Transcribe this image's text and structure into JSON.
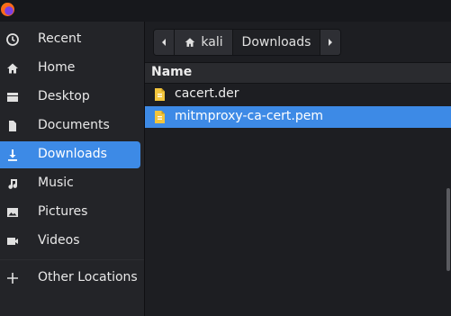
{
  "sidebar": {
    "items": [
      {
        "label": "Recent",
        "icon": "clock-icon"
      },
      {
        "label": "Home",
        "icon": "home-icon"
      },
      {
        "label": "Desktop",
        "icon": "desktop-icon"
      },
      {
        "label": "Documents",
        "icon": "document-icon"
      },
      {
        "label": "Downloads",
        "icon": "download-icon",
        "active": true
      },
      {
        "label": "Music",
        "icon": "music-icon"
      },
      {
        "label": "Pictures",
        "icon": "picture-icon"
      },
      {
        "label": "Videos",
        "icon": "video-icon"
      },
      {
        "label": "Other Locations",
        "icon": "plus-icon"
      }
    ]
  },
  "pathbar": {
    "home_label": "kali",
    "current_label": "Downloads"
  },
  "file_list": {
    "column_name": "Name",
    "files": [
      {
        "name": "cacert.der",
        "selected": false
      },
      {
        "name": "mitmproxy-ca-cert.pem",
        "selected": true
      }
    ]
  },
  "colors": {
    "accent": "#3d8ae6",
    "sidebar_bg": "#232428",
    "main_bg": "#1d1e22",
    "file_icon": "#f2c53d"
  }
}
